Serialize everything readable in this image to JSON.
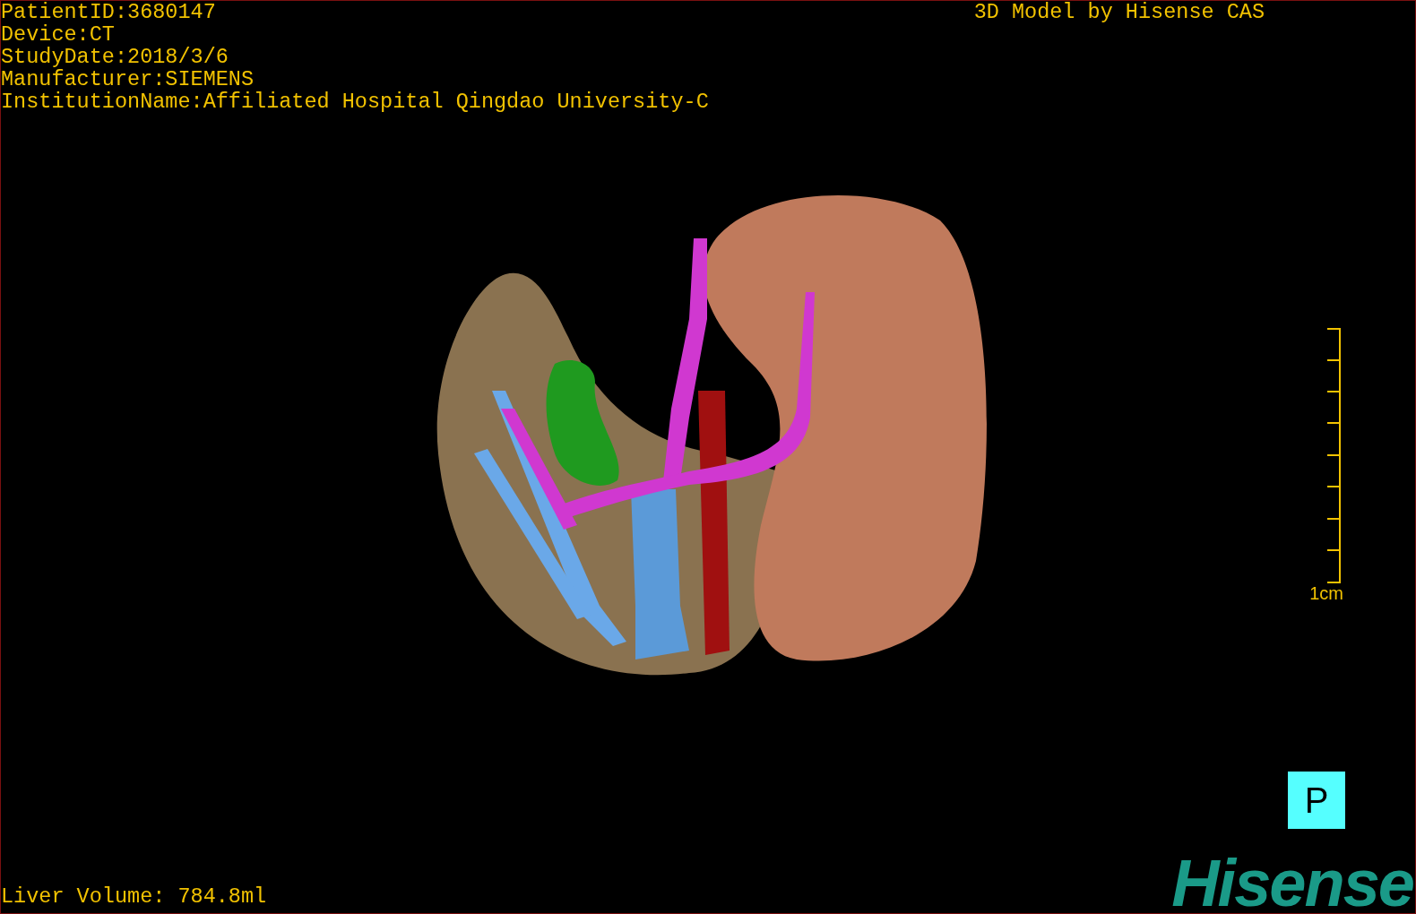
{
  "info_lines": [
    "PatientID:3680147",
    "Device:CT",
    "StudyDate:2018/3/6",
    "Manufacturer:SIEMENS",
    "InstitutionName:Affiliated Hospital Qingdao University-C"
  ],
  "title": "3D Model by Hisense CAS",
  "scale_bar": {
    "label": "1cm"
  },
  "orientation": "P",
  "liver_volume": "Liver Volume: 784.8ml",
  "logo": "Hisense"
}
